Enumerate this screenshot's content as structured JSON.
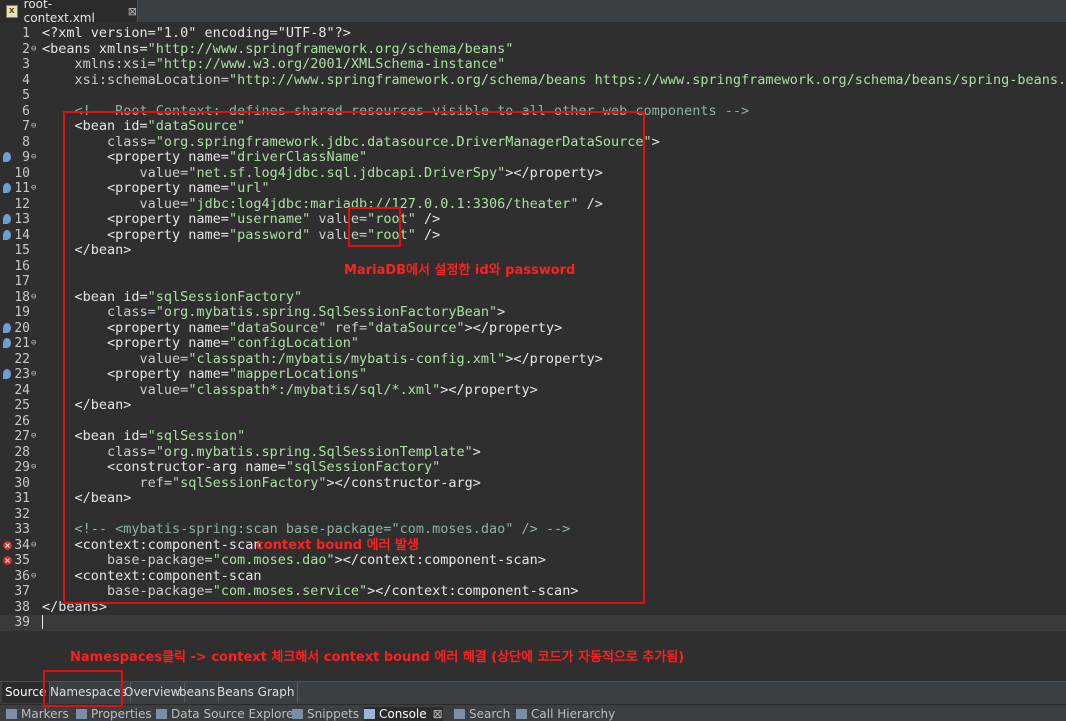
{
  "tab": {
    "title": "root-context.xml",
    "close": "⊠"
  },
  "lines": [
    {
      "n": "1",
      "fold": "",
      "mark": "",
      "parts": [
        [
          "t",
          "<?xml version=\"1.0\" encoding=\"UTF-8\"?>"
        ]
      ]
    },
    {
      "n": "2",
      "fold": "⊖",
      "mark": "",
      "parts": [
        [
          "t",
          "<beans xmlns="
        ],
        [
          "v",
          "\"http://www.springframework.org/schema/beans\""
        ]
      ]
    },
    {
      "n": "3",
      "fold": "",
      "mark": "",
      "parts": [
        [
          "a",
          "    xmlns:xsi="
        ],
        [
          "v",
          "\"http://www.w3.org/2001/XMLSchema-instance\""
        ]
      ]
    },
    {
      "n": "4",
      "fold": "",
      "mark": "",
      "parts": [
        [
          "a",
          "    xsi:schemaLocation="
        ],
        [
          "v",
          "\"http://www.springframework.org/schema/beans https://www.springframework.org/schema/beans/spring-beans.xsd\""
        ],
        [
          "t",
          ">"
        ]
      ]
    },
    {
      "n": "5",
      "fold": "",
      "mark": "",
      "parts": []
    },
    {
      "n": "6",
      "fold": "",
      "mark": "",
      "parts": [
        [
          "c",
          "    <!-- Root Context: defines shared resources visible to all other web components -->"
        ]
      ]
    },
    {
      "n": "7",
      "fold": "⊖",
      "mark": "",
      "parts": [
        [
          "t",
          "    <bean id="
        ],
        [
          "v",
          "\"dataSource\""
        ]
      ]
    },
    {
      "n": "8",
      "fold": "",
      "mark": "",
      "parts": [
        [
          "a",
          "        class="
        ],
        [
          "v",
          "\"org.springframework.jdbc.datasource.DriverManagerDataSource\""
        ],
        [
          "t",
          ">"
        ]
      ]
    },
    {
      "n": "9",
      "fold": "⊖",
      "mark": "info",
      "parts": [
        [
          "t",
          "        <property name="
        ],
        [
          "v",
          "\"driverClassName\""
        ]
      ]
    },
    {
      "n": "10",
      "fold": "",
      "mark": "",
      "parts": [
        [
          "a",
          "            value="
        ],
        [
          "v",
          "\"net.sf.log4jdbc.sql.jdbcapi.DriverSpy\""
        ],
        [
          "t",
          "></property>"
        ]
      ]
    },
    {
      "n": "11",
      "fold": "⊖",
      "mark": "info",
      "parts": [
        [
          "t",
          "        <property name="
        ],
        [
          "v",
          "\"url\""
        ]
      ]
    },
    {
      "n": "12",
      "fold": "",
      "mark": "",
      "parts": [
        [
          "a",
          "            value="
        ],
        [
          "v",
          "\"jdbc:log4jdbc:mariadb://127.0.0.1:3306/theater\""
        ],
        [
          "t",
          " />"
        ]
      ]
    },
    {
      "n": "13",
      "fold": "",
      "mark": "info",
      "parts": [
        [
          "t",
          "        <property name="
        ],
        [
          "v",
          "\"username\""
        ],
        [
          "a",
          " value="
        ],
        [
          "v",
          "\"root\""
        ],
        [
          "t",
          " />"
        ]
      ]
    },
    {
      "n": "14",
      "fold": "",
      "mark": "info",
      "parts": [
        [
          "t",
          "        <property name="
        ],
        [
          "v",
          "\"password\""
        ],
        [
          "a",
          " value="
        ],
        [
          "v",
          "\"root\""
        ],
        [
          "t",
          " />"
        ]
      ]
    },
    {
      "n": "15",
      "fold": "",
      "mark": "",
      "parts": [
        [
          "t",
          "    </bean>"
        ]
      ]
    },
    {
      "n": "16",
      "fold": "",
      "mark": "",
      "parts": []
    },
    {
      "n": "17",
      "fold": "",
      "mark": "",
      "parts": []
    },
    {
      "n": "18",
      "fold": "⊖",
      "mark": "",
      "parts": [
        [
          "t",
          "    <bean id="
        ],
        [
          "v",
          "\"sqlSessionFactory\""
        ]
      ]
    },
    {
      "n": "19",
      "fold": "",
      "mark": "",
      "parts": [
        [
          "a",
          "        class="
        ],
        [
          "v",
          "\"org.mybatis.spring.SqlSessionFactoryBean\""
        ],
        [
          "t",
          ">"
        ]
      ]
    },
    {
      "n": "20",
      "fold": "",
      "mark": "info",
      "parts": [
        [
          "t",
          "        <property name="
        ],
        [
          "v",
          "\"dataSource\""
        ],
        [
          "a",
          " ref="
        ],
        [
          "v",
          "\"dataSource\""
        ],
        [
          "t",
          "></property>"
        ]
      ]
    },
    {
      "n": "21",
      "fold": "⊖",
      "mark": "info",
      "parts": [
        [
          "t",
          "        <property name="
        ],
        [
          "v",
          "\"configLocation\""
        ]
      ]
    },
    {
      "n": "22",
      "fold": "",
      "mark": "",
      "parts": [
        [
          "a",
          "            value="
        ],
        [
          "v",
          "\"classpath:/mybatis/mybatis-config.xml\""
        ],
        [
          "t",
          "></property>"
        ]
      ]
    },
    {
      "n": "23",
      "fold": "⊖",
      "mark": "info",
      "parts": [
        [
          "t",
          "        <property name="
        ],
        [
          "v",
          "\"mapperLocations\""
        ]
      ]
    },
    {
      "n": "24",
      "fold": "",
      "mark": "",
      "parts": [
        [
          "a",
          "            value="
        ],
        [
          "v",
          "\"classpath*:/mybatis/sql/*.xml\""
        ],
        [
          "t",
          "></property>"
        ]
      ]
    },
    {
      "n": "25",
      "fold": "",
      "mark": "",
      "parts": [
        [
          "t",
          "    </bean>"
        ]
      ]
    },
    {
      "n": "26",
      "fold": "",
      "mark": "",
      "parts": []
    },
    {
      "n": "27",
      "fold": "⊖",
      "mark": "",
      "parts": [
        [
          "t",
          "    <bean id="
        ],
        [
          "v",
          "\"sqlSession\""
        ]
      ]
    },
    {
      "n": "28",
      "fold": "",
      "mark": "",
      "parts": [
        [
          "a",
          "        class="
        ],
        [
          "v",
          "\"org.mybatis.spring.SqlSessionTemplate\""
        ],
        [
          "t",
          ">"
        ]
      ]
    },
    {
      "n": "29",
      "fold": "⊖",
      "mark": "",
      "parts": [
        [
          "t",
          "        <constructor-arg name="
        ],
        [
          "v",
          "\"sqlSessionFactory\""
        ]
      ]
    },
    {
      "n": "30",
      "fold": "",
      "mark": "",
      "parts": [
        [
          "a",
          "            ref="
        ],
        [
          "v",
          "\"sqlSessionFactory\""
        ],
        [
          "t",
          "></constructor-arg>"
        ]
      ]
    },
    {
      "n": "31",
      "fold": "",
      "mark": "",
      "parts": [
        [
          "t",
          "    </bean>"
        ]
      ]
    },
    {
      "n": "32",
      "fold": "",
      "mark": "",
      "parts": []
    },
    {
      "n": "33",
      "fold": "",
      "mark": "",
      "parts": [
        [
          "c",
          "    <!-- <mybatis-spring:scan base-package=\"com.moses.dao\" /> -->"
        ]
      ]
    },
    {
      "n": "34",
      "fold": "⊖",
      "mark": "err",
      "parts": [
        [
          "t",
          "    <context:component-scan"
        ]
      ]
    },
    {
      "n": "35",
      "fold": "",
      "mark": "err",
      "parts": [
        [
          "a",
          "        base-package="
        ],
        [
          "v",
          "\"com.moses.dao\""
        ],
        [
          "t",
          "></context:component-scan>"
        ]
      ]
    },
    {
      "n": "36",
      "fold": "⊖",
      "mark": "",
      "parts": [
        [
          "t",
          "    <context:component-scan"
        ]
      ]
    },
    {
      "n": "37",
      "fold": "",
      "mark": "",
      "parts": [
        [
          "a",
          "        base-package="
        ],
        [
          "v",
          "\"com.moses.service\""
        ],
        [
          "t",
          "></context:component-scan>"
        ]
      ]
    },
    {
      "n": "38",
      "fold": "",
      "mark": "",
      "parts": [
        [
          "t",
          "</beans>"
        ]
      ]
    },
    {
      "n": "39",
      "fold": "",
      "mark": "",
      "parts": [],
      "current": true
    }
  ],
  "annotations": {
    "credentials": "MariaDB에서 설정한 id와 password",
    "context_error": "context bound 에러 발생",
    "namespaces_hint": "Namespaces클릭 -> context 체크해서 context bound 에러 해결 (상단에 코드가 자동적으로 추가됨)"
  },
  "editor_tabs": [
    "Source",
    "Namespaces",
    "Overview",
    "beans",
    "Beans Graph"
  ],
  "views": [
    "Markers",
    "Properties",
    "Data Source Explorer",
    "Snippets",
    "Console",
    "Search",
    "Call Hierarchy"
  ],
  "console_close": "⊠",
  "colors": {
    "annotation": "#ff2020",
    "box": "#e01010"
  }
}
